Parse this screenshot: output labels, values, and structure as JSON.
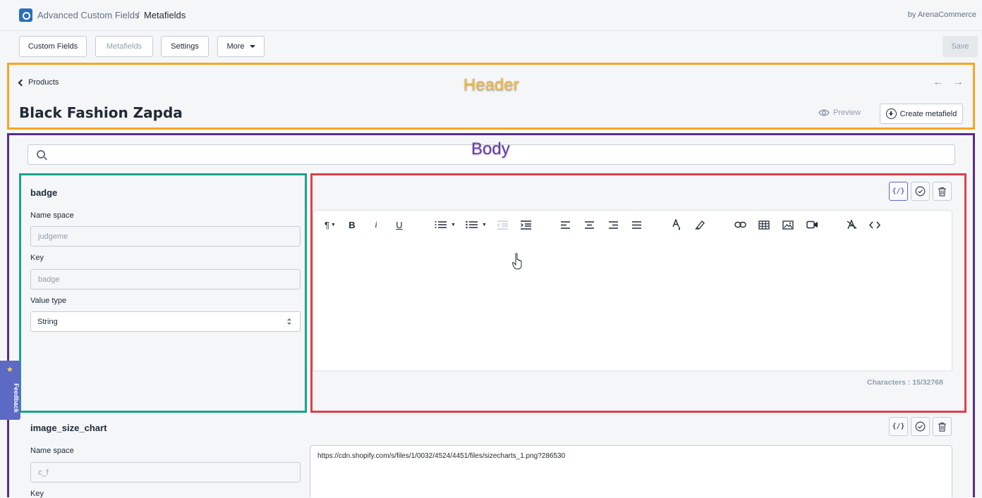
{
  "topbar": {
    "app_name": "Advanced Custom Fields",
    "separator": "/",
    "page_name": "Metafields",
    "byline": "by ArenaCommerce"
  },
  "nav": {
    "custom_fields": "Custom Fields",
    "metafields": "Metafields",
    "settings": "Settings",
    "more": "More",
    "save": "Save"
  },
  "header": {
    "annotation": "Header",
    "back_label": "Products",
    "title": "Black Fashion Zapda",
    "preview": "Preview",
    "create": "Create metafield"
  },
  "body": {
    "annotation": "Body",
    "search_placeholder": ""
  },
  "fields": [
    {
      "name": "badge",
      "namespace_label": "Name space",
      "namespace_value": "judgeme",
      "key_label": "Key",
      "key_value": "badge",
      "value_type_label": "Value type",
      "value_type": "String",
      "char_count": "Characters : 15/32768"
    },
    {
      "name": "image_size_chart",
      "namespace_label": "Name space",
      "namespace_value": "c_f",
      "key_label": "Key",
      "value": "https://cdn.shopify.com/s/files/1/0032/4524/4451/files/sizecharts_1.png?286530"
    }
  ],
  "feedback": "Feedback",
  "colors": {
    "header_box": "#f5a623",
    "body_box": "#5b2c86",
    "field_box": "#1aa38a",
    "editor_box": "#e0404a"
  }
}
